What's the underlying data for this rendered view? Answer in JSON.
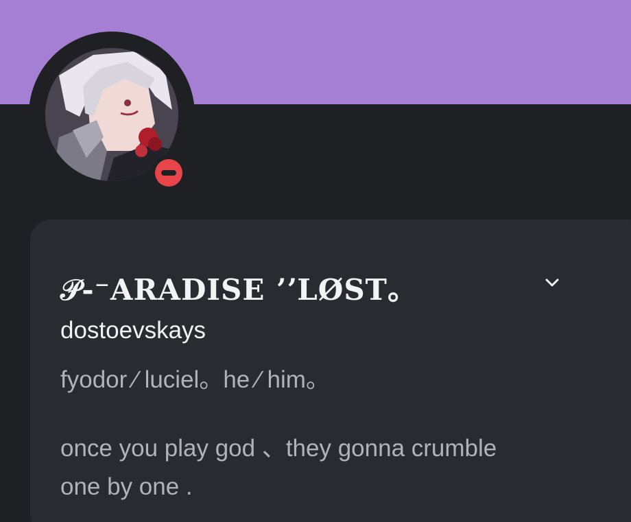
{
  "profile": {
    "banner_color": "#a57fd4",
    "status": "do-not-disturb",
    "status_color": "#e8454a",
    "display_name": "𝒫-⁻ARADISE ʼʼLØST。",
    "username": "dostoevskays",
    "pronouns": "fyodor ∕ luciel。he ∕ him。",
    "bio_lines": [
      "once you play god 、they gonna crumble",
      "one by one ."
    ]
  },
  "icons": {
    "status": "do-not-disturb-icon",
    "expand": "chevron-down-icon"
  }
}
